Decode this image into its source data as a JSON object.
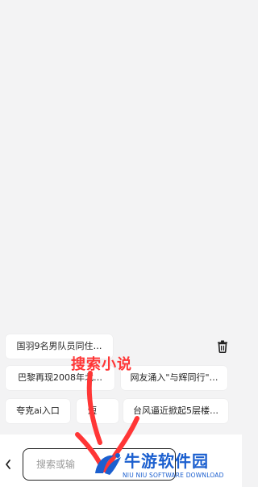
{
  "suggestions": {
    "row1": [
      "国羽9名男队员同住…"
    ],
    "row2": [
      "巴黎再现2008年北…",
      "网友涌入\"与辉同行\"…"
    ],
    "row3": [
      "夸克ai入口",
      "短",
      "台风逼近掀起5层楼…"
    ]
  },
  "icons": {
    "trash": "trash-icon",
    "back": "chevron-left-icon",
    "watermark_logo": "niuniu-logo-icon"
  },
  "search": {
    "placeholder": "搜索或输"
  },
  "annotation": {
    "text": "搜索小说",
    "color": "#ff3636"
  },
  "watermark": {
    "title": "牛游软件园",
    "subtitle": "NIU NIU SOFTWARE DOWNLOAD",
    "color": "#1b5fcf"
  }
}
